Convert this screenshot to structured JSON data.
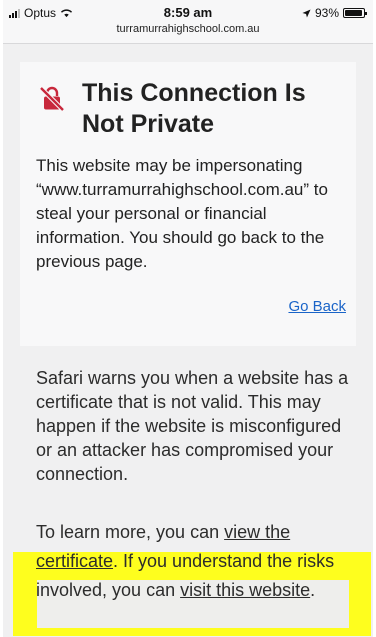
{
  "status_bar": {
    "carrier": "Optus",
    "time": "8:59 am",
    "url": "turramurrahighschool.com.au",
    "battery": "93%",
    "battery_level": 0.93
  },
  "warning": {
    "title": "This Connection Is Not Private",
    "description": "This website may be impersonating “www.turramurrahighschool.com.au” to steal your personal or financial information. You should go back to the previous page.",
    "go_back_label": "Go Back"
  },
  "details": {
    "info": "Safari warns you when a website has a certificate that is not valid. This may happen if the website is misconfigured or an attacker has compromised your connection.",
    "learn_prefix": "To learn more, you can ",
    "view_link": "view the certificate",
    "middle": ". If you understand the risks involved, you can ",
    "visit_link": "visit this website",
    "suffix": "."
  },
  "colors": {
    "link": "#1a64c8",
    "warning_icon": "#c8283c",
    "highlight": "#ffff00"
  }
}
